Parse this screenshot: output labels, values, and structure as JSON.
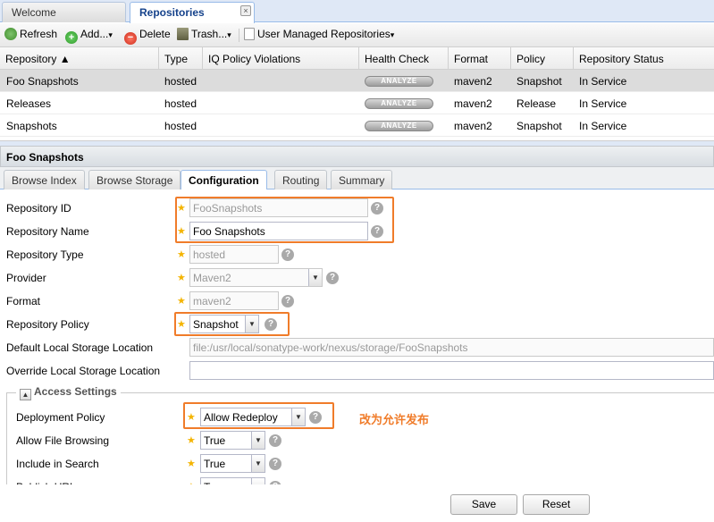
{
  "tabs": [
    {
      "label": "Welcome",
      "active": false
    },
    {
      "label": "Repositories",
      "active": true,
      "close": "×"
    }
  ],
  "toolbar": {
    "refresh": "Refresh",
    "add": "Add...",
    "delete": "Delete",
    "trash": "Trash...",
    "user_managed": "User Managed Repositories",
    "dropdown_glyph": "▾"
  },
  "grid": {
    "columns": [
      "Repository ▲",
      "Type",
      "IQ Policy Violations",
      "Health Check",
      "Format",
      "Policy",
      "Repository Status"
    ],
    "analyze_label": "ANALYZE",
    "rows": [
      {
        "name": "Foo Snapshots",
        "type": "hosted",
        "iq": "",
        "format": "maven2",
        "policy": "Snapshot",
        "status": "In Service",
        "selected": true
      },
      {
        "name": "Releases",
        "type": "hosted",
        "iq": "",
        "format": "maven2",
        "policy": "Release",
        "status": "In Service",
        "selected": false
      },
      {
        "name": "Snapshots",
        "type": "hosted",
        "iq": "",
        "format": "maven2",
        "policy": "Snapshot",
        "status": "In Service",
        "selected": false
      }
    ]
  },
  "detail": {
    "title": "Foo Snapshots",
    "tabs": [
      "Browse Index",
      "Browse Storage",
      "Configuration",
      "Routing",
      "Summary"
    ],
    "active_tab": "Configuration"
  },
  "form": {
    "repository_id": {
      "label": "Repository ID",
      "value": "FooSnapshots"
    },
    "repository_name": {
      "label": "Repository Name",
      "value": "Foo Snapshots"
    },
    "repository_type": {
      "label": "Repository Type",
      "value": "hosted"
    },
    "provider": {
      "label": "Provider",
      "value": "Maven2"
    },
    "format": {
      "label": "Format",
      "value": "maven2"
    },
    "repository_policy": {
      "label": "Repository Policy",
      "value": "Snapshot"
    },
    "default_storage": {
      "label": "Default Local Storage Location",
      "value": "file:/usr/local/sonatype-work/nexus/storage/FooSnapshots"
    },
    "override_storage": {
      "label": "Override Local Storage Location",
      "value": ""
    },
    "access_settings": {
      "legend": "Access Settings",
      "collapse_glyph": "▲",
      "deployment_policy": {
        "label": "Deployment Policy",
        "value": "Allow Redeploy"
      },
      "allow_file_browsing": {
        "label": "Allow File Browsing",
        "value": "True"
      },
      "include_in_search": {
        "label": "Include in Search",
        "value": "True"
      },
      "publish_url": {
        "label": "Publish URL",
        "value": "True"
      }
    },
    "annotation": "改为允许发布",
    "star": "★",
    "help": "?",
    "combo_glyph": "▼"
  },
  "buttons": {
    "save": "Save",
    "reset": "Reset"
  },
  "colors": {
    "highlight": "#f07c2a",
    "required_star": "#f4b400"
  }
}
